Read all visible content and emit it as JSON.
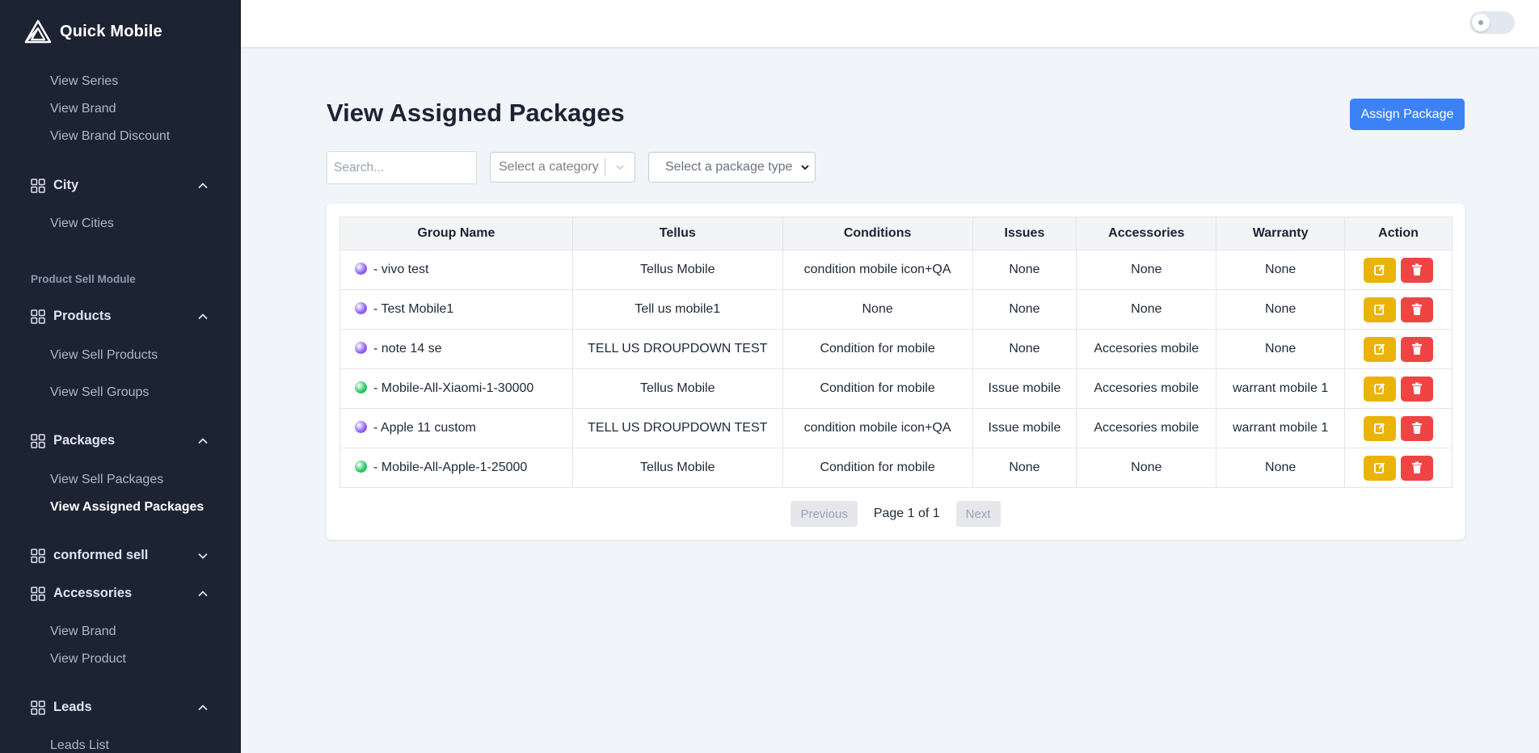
{
  "brand": {
    "name": "Quick Mobile"
  },
  "sidebar": {
    "links_top": [
      "View Series",
      "View Brand",
      "View Brand Discount"
    ],
    "city": {
      "label": "City",
      "links": [
        "View Cities"
      ]
    },
    "section": "Product Sell Module",
    "products": {
      "label": "Products",
      "links": [
        "View Sell Products",
        "View Sell Groups"
      ]
    },
    "packages": {
      "label": "Packages",
      "links": [
        "View Sell Packages",
        "View Assigned Packages"
      ]
    },
    "conformed": {
      "label": "conformed sell"
    },
    "accessories": {
      "label": "Accessories",
      "links": [
        "View Brand",
        "View Product"
      ]
    },
    "leads": {
      "label": "Leads",
      "links": [
        "Leads List"
      ]
    }
  },
  "page": {
    "title": "View Assigned Packages",
    "assign_label": "Assign Package",
    "search_placeholder": "Search...",
    "category_placeholder": "Select a category",
    "package_type_placeholder": "Select a package type"
  },
  "table": {
    "headers": [
      "Group Name",
      "Tellus",
      "Conditions",
      "Issues",
      "Accessories",
      "Warranty",
      "Action"
    ],
    "rows": [
      {
        "dot": "#8b5cf6",
        "group": "- vivo test",
        "tellus": "Tellus Mobile",
        "conditions": "condition mobile icon+QA",
        "issues": "None",
        "accessories": "None",
        "warranty": "None"
      },
      {
        "dot": "#8b5cf6",
        "group": "- Test Mobile1",
        "tellus": "Tell us mobile1",
        "conditions": "None",
        "issues": "None",
        "accessories": "None",
        "warranty": "None"
      },
      {
        "dot": "#8b5cf6",
        "group": "- note 14 se",
        "tellus": "TELL US DROUPDOWN TEST",
        "conditions": "Condition for mobile",
        "issues": "None",
        "accessories": "Accesories mobile",
        "warranty": "None"
      },
      {
        "dot": "#22c55e",
        "group": "- Mobile-All-Xiaomi-1-30000",
        "tellus": "Tellus Mobile",
        "conditions": "Condition for mobile",
        "issues": "Issue mobile",
        "accessories": "Accesories mobile",
        "warranty": "warrant mobile 1"
      },
      {
        "dot": "#8b5cf6",
        "group": "- Apple 11 custom",
        "tellus": "TELL US DROUPDOWN TEST",
        "conditions": "condition mobile icon+QA",
        "issues": "Issue mobile",
        "accessories": "Accesories mobile",
        "warranty": "warrant mobile 1"
      },
      {
        "dot": "#22c55e",
        "group": "- Mobile-All-Apple-1-25000",
        "tellus": "Tellus Mobile",
        "conditions": "Condition for mobile",
        "issues": "None",
        "accessories": "None",
        "warranty": "None"
      }
    ]
  },
  "pagination": {
    "previous": "Previous",
    "page_text": "Page 1 of 1",
    "next": "Next"
  },
  "colors": {
    "sidebar_bg": "#1c2434",
    "primary": "#3c82f6",
    "edit": "#eab308",
    "delete": "#ef4444"
  }
}
